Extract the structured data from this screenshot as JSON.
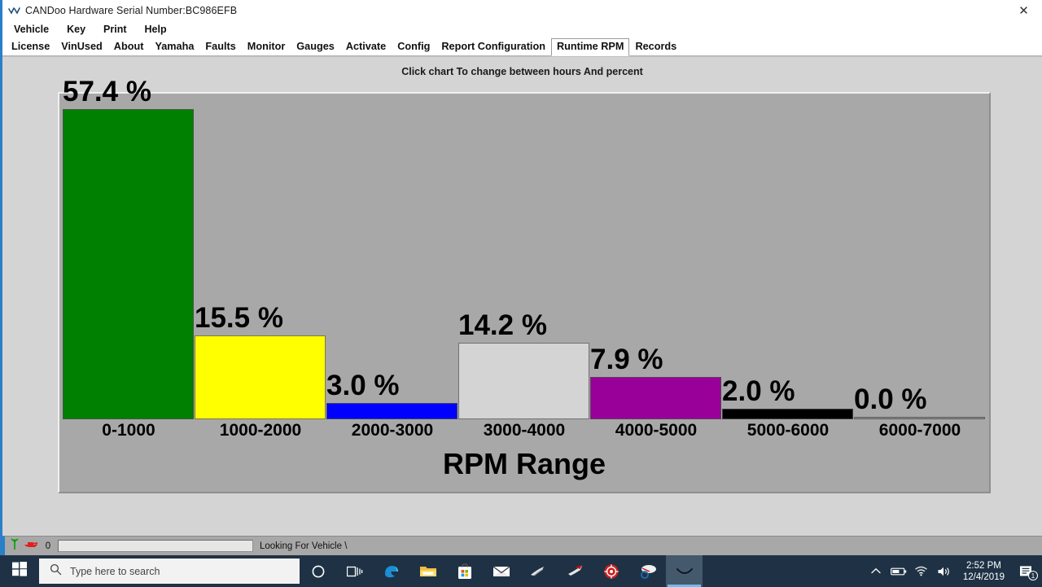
{
  "window": {
    "title": "CANDoo  Hardware Serial Number:BC986EFB",
    "icon": "candoo-wave-icon",
    "close_label": "✕"
  },
  "menubar": {
    "items": [
      {
        "label": "Vehicle"
      },
      {
        "label": "Key"
      },
      {
        "label": "Print"
      },
      {
        "label": "Help"
      }
    ]
  },
  "tabs": [
    {
      "label": "License",
      "active": false
    },
    {
      "label": "VinUsed",
      "active": false
    },
    {
      "label": "About",
      "active": false
    },
    {
      "label": "Yamaha",
      "active": false
    },
    {
      "label": "Faults",
      "active": false
    },
    {
      "label": "Monitor",
      "active": false
    },
    {
      "label": "Gauges",
      "active": false
    },
    {
      "label": "Activate",
      "active": false
    },
    {
      "label": "Config",
      "active": false
    },
    {
      "label": "Report Configuration",
      "active": false
    },
    {
      "label": "Runtime RPM",
      "active": true
    },
    {
      "label": "Records",
      "active": false
    }
  ],
  "main": {
    "hint": "Click chart To change between hours And percent"
  },
  "chart_data": {
    "type": "bar",
    "title": "",
    "xlabel": "RPM Range",
    "ylabel": "",
    "ylim": [
      0,
      60
    ],
    "grid": false,
    "legend": "none",
    "unit": "%",
    "categories": [
      "0-1000",
      "1000-2000",
      "2000-3000",
      "3000-4000",
      "4000-5000",
      "5000-6000",
      "6000-7000"
    ],
    "values": [
      57.4,
      15.5,
      3.0,
      14.2,
      7.9,
      2.0,
      0.0
    ],
    "value_labels": [
      "57.4 %",
      "15.5 %",
      "3.0 %",
      "14.2 %",
      "7.9 %",
      "2.0 %",
      "0.0 %"
    ],
    "colors": [
      "#008000",
      "#ffff00",
      "#0000ff",
      "#d4d4d4",
      "#990099",
      "#000000",
      "#8a8a8a"
    ],
    "background": "#a8a8a8"
  },
  "statusbar": {
    "count": "0",
    "message": "Looking For Vehicle \\",
    "link_icon": "green-antenna-icon",
    "boat_icon": "red-boat-icon"
  },
  "taskbar": {
    "start_icon": "windows-logo-icon",
    "search_placeholder": "Type here to search",
    "search_icon": "search-icon",
    "items": [
      {
        "name": "cortana-icon"
      },
      {
        "name": "task-view-icon"
      },
      {
        "name": "edge-browser-icon"
      },
      {
        "name": "file-explorer-icon"
      },
      {
        "name": "microsoft-store-icon"
      },
      {
        "name": "mail-icon"
      },
      {
        "name": "seadoo-app-icon"
      },
      {
        "name": "ski-doo-app-icon"
      },
      {
        "name": "brp-diagnostic-icon"
      },
      {
        "name": "candoo-pro-icon"
      },
      {
        "name": "candoo-active-icon"
      }
    ],
    "tray": {
      "chevron_icon": "show-hidden-icons-icon",
      "battery_icon": "battery-icon",
      "wifi_icon": "wifi-icon",
      "volume_icon": "volume-icon",
      "time": "2:52 PM",
      "date": "12/4/2019",
      "notification_icon": "action-center-icon",
      "notification_count": "1"
    }
  }
}
